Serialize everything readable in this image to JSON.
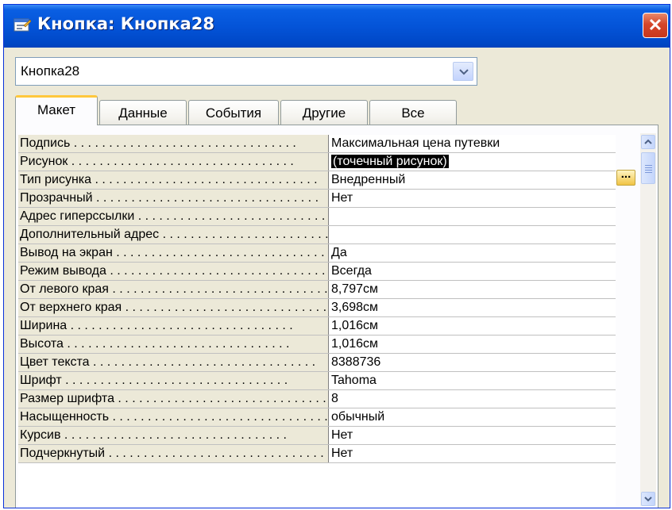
{
  "window": {
    "title": "Кнопка: Кнопка28",
    "close_label": "✕"
  },
  "selector": {
    "value": "Кнопка28"
  },
  "tabs": [
    "Макет",
    "Данные",
    "События",
    "Другие",
    "Все"
  ],
  "properties": [
    {
      "name": "Подпись",
      "value": "Максимальная цена путевки"
    },
    {
      "name": "Рисунок",
      "value": "(точечный рисунок)"
    },
    {
      "name": "Тип рисунка",
      "value": "Внедренный"
    },
    {
      "name": "Прозрачный",
      "value": "Нет"
    },
    {
      "name": "Адрес гиперссылки",
      "value": ""
    },
    {
      "name": "Дополнительный адрес",
      "value": ""
    },
    {
      "name": "Вывод на экран",
      "value": "Да"
    },
    {
      "name": "Режим вывода",
      "value": "Всегда"
    },
    {
      "name": "От левого края",
      "value": "8,797см"
    },
    {
      "name": "От верхнего края",
      "value": "3,698см"
    },
    {
      "name": "Ширина",
      "value": "1,016см"
    },
    {
      "name": "Высота",
      "value": "1,016см"
    },
    {
      "name": "Цвет текста",
      "value": "8388736"
    },
    {
      "name": "Шрифт",
      "value": "Tahoma"
    },
    {
      "name": "Размер шрифта",
      "value": "8"
    },
    {
      "name": "Насыщенность",
      "value": "обычный"
    },
    {
      "name": "Курсив",
      "value": "Нет"
    },
    {
      "name": "Подчеркнутый",
      "value": "Нет"
    }
  ],
  "builder_button": {
    "label": "..."
  },
  "icons": {
    "title": "form-properties-icon",
    "dropdown": "chevron-down-icon",
    "scroll_up": "arrow-up-icon",
    "scroll_down": "arrow-down-icon"
  },
  "colors": {
    "titlebar": "#0454d8",
    "close": "#d5462a",
    "active_tab_accent": "#ffc83c",
    "selection": "#000000"
  }
}
